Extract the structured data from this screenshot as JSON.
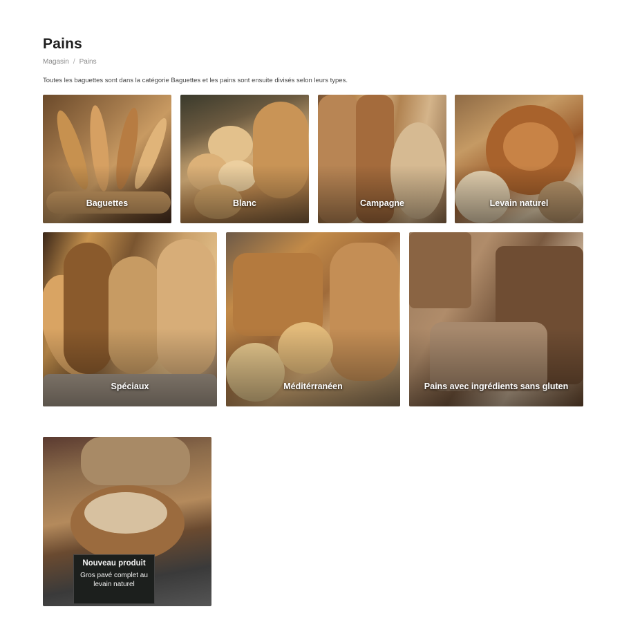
{
  "page": {
    "title": "Pains",
    "intro": "Toutes les baguettes sont dans la catégorie Baguettes et les pains sont ensuite divisés selon leurs types."
  },
  "breadcrumb": {
    "home": "Magasin",
    "separator": "/",
    "current": "Pains"
  },
  "categories": [
    {
      "label": "Baguettes"
    },
    {
      "label": "Blanc"
    },
    {
      "label": "Campagne"
    },
    {
      "label": "Levain naturel"
    },
    {
      "label": "Spéciaux"
    },
    {
      "label": "Méditérranéen"
    },
    {
      "label": "Pains avec ingrédients sans gluten"
    }
  ],
  "promo": {
    "sign_title": "Nouveau produit",
    "sign_text": "Gros pavé complet au levain naturel"
  }
}
